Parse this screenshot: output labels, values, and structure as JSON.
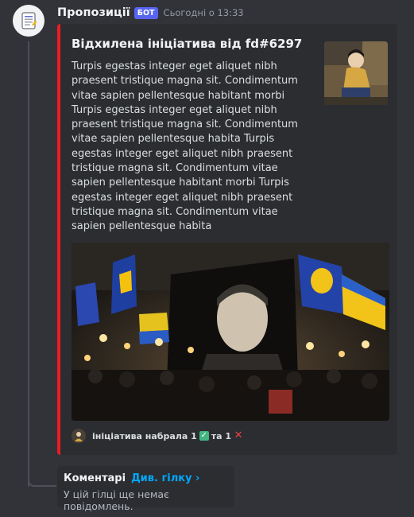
{
  "message": {
    "author": "Пропозиції",
    "bot_badge": "БОТ",
    "timestamp": "Сьогодні о 13:33",
    "avatar_icon": "document-icon"
  },
  "embed": {
    "accent_color": "#ed1c24",
    "title": "Відхилена ініціатива від fd#6297",
    "description": "Turpis egestas integer eget aliquet nibh praesent tristique magna sit. Condimentum vitae sapien pellentesque habitant morbi Turpis egestas integer eget aliquet nibh praesent tristique magna sit. Condimentum vitae sapien pellentesque habita Turpis egestas integer eget aliquet nibh praesent tristique magna sit. Condimentum vitae sapien pellentesque habitant morbi Turpis egestas integer eget aliquet nibh praesent tristique magna sit. Condimentum vitae sapien pellentesque habita",
    "footer": {
      "text_before": "ініціатива набрала 1",
      "text_middle": "та 1",
      "check_icon": "check-mark-icon",
      "cross_icon": "cross-mark-icon"
    }
  },
  "thread": {
    "title": "Коментарі",
    "link": "Див. гілку ›",
    "empty_text": "У цій гілці ще немає повідомлень."
  }
}
